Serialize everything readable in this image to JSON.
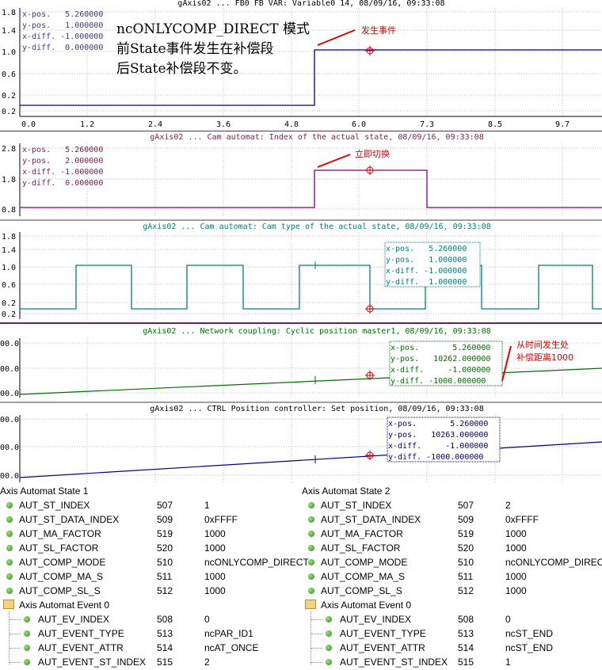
{
  "charts": [
    {
      "title": "gAxis02 ... FB0 FB VAR: Variable0 14, 08/09/16, 09:33:08",
      "title_color": "#000000",
      "line_color": "#00007a",
      "y_ticks": [
        "1.8",
        "1.4",
        "1.0",
        "0.6",
        "0.2",
        "-0.2"
      ],
      "x_ticks": [
        "0.0",
        "1.2",
        "2.4",
        "3.6",
        "4.8",
        "6.0",
        "7.3",
        "8.5",
        "9.7"
      ],
      "cursor": [
        "x-pos.   5.260000",
        "y-pos.   1.000000",
        "x-diff. -1.000000",
        "y-diff.  0.000000"
      ],
      "cursor_color": "#3c3c80"
    },
    {
      "title": "gAxis02 ... Cam automat: Index of the actual state, 08/09/16, 09:33:08",
      "title_color": "#7a1f4a",
      "line_color": "#800080",
      "y_ticks": [
        "2.8",
        "1.8",
        "0.8"
      ],
      "cursor": [
        "x-pos.   5.260000",
        "y-pos.   2.000000",
        "x-diff. -1.000000",
        "y-diff.  0.000000"
      ],
      "cursor_color": "#7a1f4a"
    },
    {
      "title": "gAxis02 ... Cam automat: Cam type of the actual state, 08/09/16, 09:33:08",
      "title_color": "#008080",
      "line_color": "#008080",
      "y_ticks": [
        "1.8",
        "1.4",
        "1.0",
        "0.6",
        "0.2",
        "-0.2"
      ],
      "cursor": [
        "x-pos.   5.260000",
        "y-pos.   1.000000",
        "x-diff. -1.000000",
        "y-diff.  1.000000"
      ],
      "cursor_color": "#008080"
    },
    {
      "title": "gAxis02 ... Network coupling: Cyclic position master1, 08/09/16, 09:33:08",
      "title_color": "#007000",
      "line_color": "#007000",
      "y_ticks": [
        "00.0",
        "00.0",
        "00.0"
      ],
      "cursor": [
        "x-pos.       5.260000",
        "y-pos.   10262.000000",
        "x-diff.     -1.000000",
        "y-diff. -1000.000000"
      ],
      "cursor_color": "#007000"
    },
    {
      "title": "gAxis02 ... CTRL Position controller: Set position, 08/09/16, 09:33:08",
      "title_color": "#000000",
      "line_color": "#000080",
      "y_ticks": [
        "00.0",
        "00.0",
        "00.0"
      ],
      "cursor": [
        "x-pos.       5.260000",
        "y-pos.   10263.000000",
        "x-diff.     -1.000000",
        "y-diff. -1000.000000"
      ],
      "cursor_color": "#000080"
    }
  ],
  "annotations": {
    "main_text": [
      "ncONLYCOMP_DIRECT 模式",
      "前State事件发生在补偿段",
      "后State补偿段不变。"
    ],
    "event_label": "发生事件",
    "switch_label": "立即切换",
    "compensation_label": [
      "从时间发生处",
      "补偿距离1000"
    ]
  },
  "tables": [
    {
      "header": "Axis Automat State 1",
      "rows": [
        {
          "name": "AUT_ST_INDEX",
          "id": "507",
          "value": "1"
        },
        {
          "name": "AUT_ST_DATA_INDEX",
          "id": "509",
          "value": "0xFFFF"
        },
        {
          "name": "AUT_MA_FACTOR",
          "id": "519",
          "value": "1000"
        },
        {
          "name": "AUT_SL_FACTOR",
          "id": "520",
          "value": "1000"
        },
        {
          "name": "AUT_COMP_MODE",
          "id": "510",
          "value": "ncONLYCOMP_DIRECT"
        },
        {
          "name": "AUT_COMP_MA_S",
          "id": "511",
          "value": "1000"
        },
        {
          "name": "AUT_COMP_SL_S",
          "id": "512",
          "value": "1000"
        }
      ],
      "event_header": "Axis Automat Event 0",
      "event_rows": [
        {
          "name": "AUT_EV_INDEX",
          "id": "508",
          "value": "0"
        },
        {
          "name": "AUT_EVENT_TYPE",
          "id": "513",
          "value": "ncPAR_ID1"
        },
        {
          "name": "AUT_EVENT_ATTR",
          "id": "514",
          "value": "ncAT_ONCE"
        },
        {
          "name": "AUT_EVENT_ST_INDEX",
          "id": "515",
          "value": "2"
        }
      ]
    },
    {
      "header": "Axis Automat State 2",
      "rows": [
        {
          "name": "AUT_ST_INDEX",
          "id": "507",
          "value": "2"
        },
        {
          "name": "AUT_ST_DATA_INDEX",
          "id": "509",
          "value": "0xFFFF"
        },
        {
          "name": "AUT_MA_FACTOR",
          "id": "519",
          "value": "1000"
        },
        {
          "name": "AUT_SL_FACTOR",
          "id": "520",
          "value": "1000"
        },
        {
          "name": "AUT_COMP_MODE",
          "id": "510",
          "value": "ncONLYCOMP_DIRECT"
        },
        {
          "name": "AUT_COMP_MA_S",
          "id": "511",
          "value": "1000"
        },
        {
          "name": "AUT_COMP_SL_S",
          "id": "512",
          "value": "1000"
        }
      ],
      "event_header": "Axis Automat Event 0",
      "event_rows": [
        {
          "name": "AUT_EV_INDEX",
          "id": "508",
          "value": "0"
        },
        {
          "name": "AUT_EVENT_TYPE",
          "id": "513",
          "value": "ncST_END"
        },
        {
          "name": "AUT_EVENT_ATTR",
          "id": "514",
          "value": "ncST_END"
        },
        {
          "name": "AUT_EVENT_ST_INDEX",
          "id": "515",
          "value": "1"
        }
      ]
    }
  ]
}
